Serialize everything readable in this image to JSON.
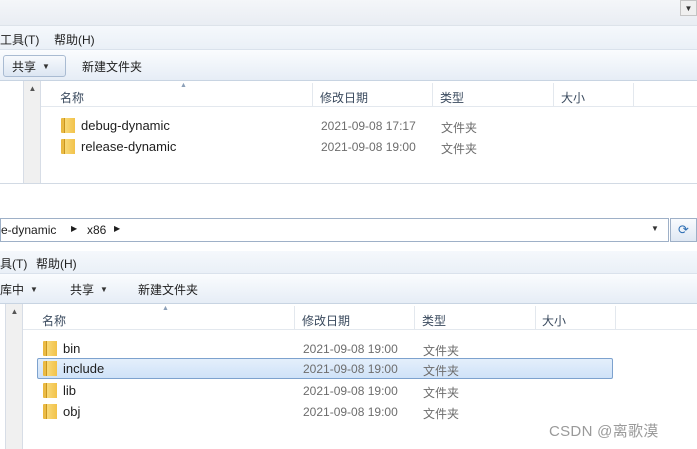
{
  "top_window": {
    "menu": {
      "tools": "工具(T)",
      "help": "帮助(H)"
    },
    "toolbar": {
      "share": "共享",
      "new_folder": "新建文件夹"
    },
    "columns": {
      "name": "名称",
      "modified": "修改日期",
      "type": "类型",
      "size": "大小"
    },
    "files": [
      {
        "name": "debug-dynamic",
        "modified": "2021-09-08 17:17",
        "type": "文件夹"
      },
      {
        "name": "release-dynamic",
        "modified": "2021-09-08 19:00",
        "type": "文件夹"
      }
    ]
  },
  "bottom_window": {
    "address": {
      "segment1": "e-dynamic",
      "segment2": "x86"
    },
    "menu": {
      "tools": "具(T)",
      "help": "帮助(H)"
    },
    "toolbar": {
      "library": "库中",
      "share": "共享",
      "new_folder": "新建文件夹"
    },
    "columns": {
      "name": "名称",
      "modified": "修改日期",
      "type": "类型",
      "size": "大小"
    },
    "files": [
      {
        "name": "bin",
        "modified": "2021-09-08 19:00",
        "type": "文件夹",
        "selected": false
      },
      {
        "name": "include",
        "modified": "2021-09-08 19:00",
        "type": "文件夹",
        "selected": true
      },
      {
        "name": "lib",
        "modified": "2021-09-08 19:00",
        "type": "文件夹",
        "selected": false
      },
      {
        "name": "obj",
        "modified": "2021-09-08 19:00",
        "type": "文件夹",
        "selected": false
      }
    ]
  },
  "watermark": "CSDN @离歌漠",
  "icons": {
    "folder": "folder-icon",
    "dropdown": "chevron-down-icon",
    "breadcrumb": "chevron-right-icon",
    "refresh": "refresh-icon",
    "sort": "sort-up-icon"
  },
  "colors": {
    "selection": "#cfe2f8",
    "selection_border": "#7da2ce",
    "folder": "#f2c24a",
    "muted_text": "#6d6d6d"
  }
}
